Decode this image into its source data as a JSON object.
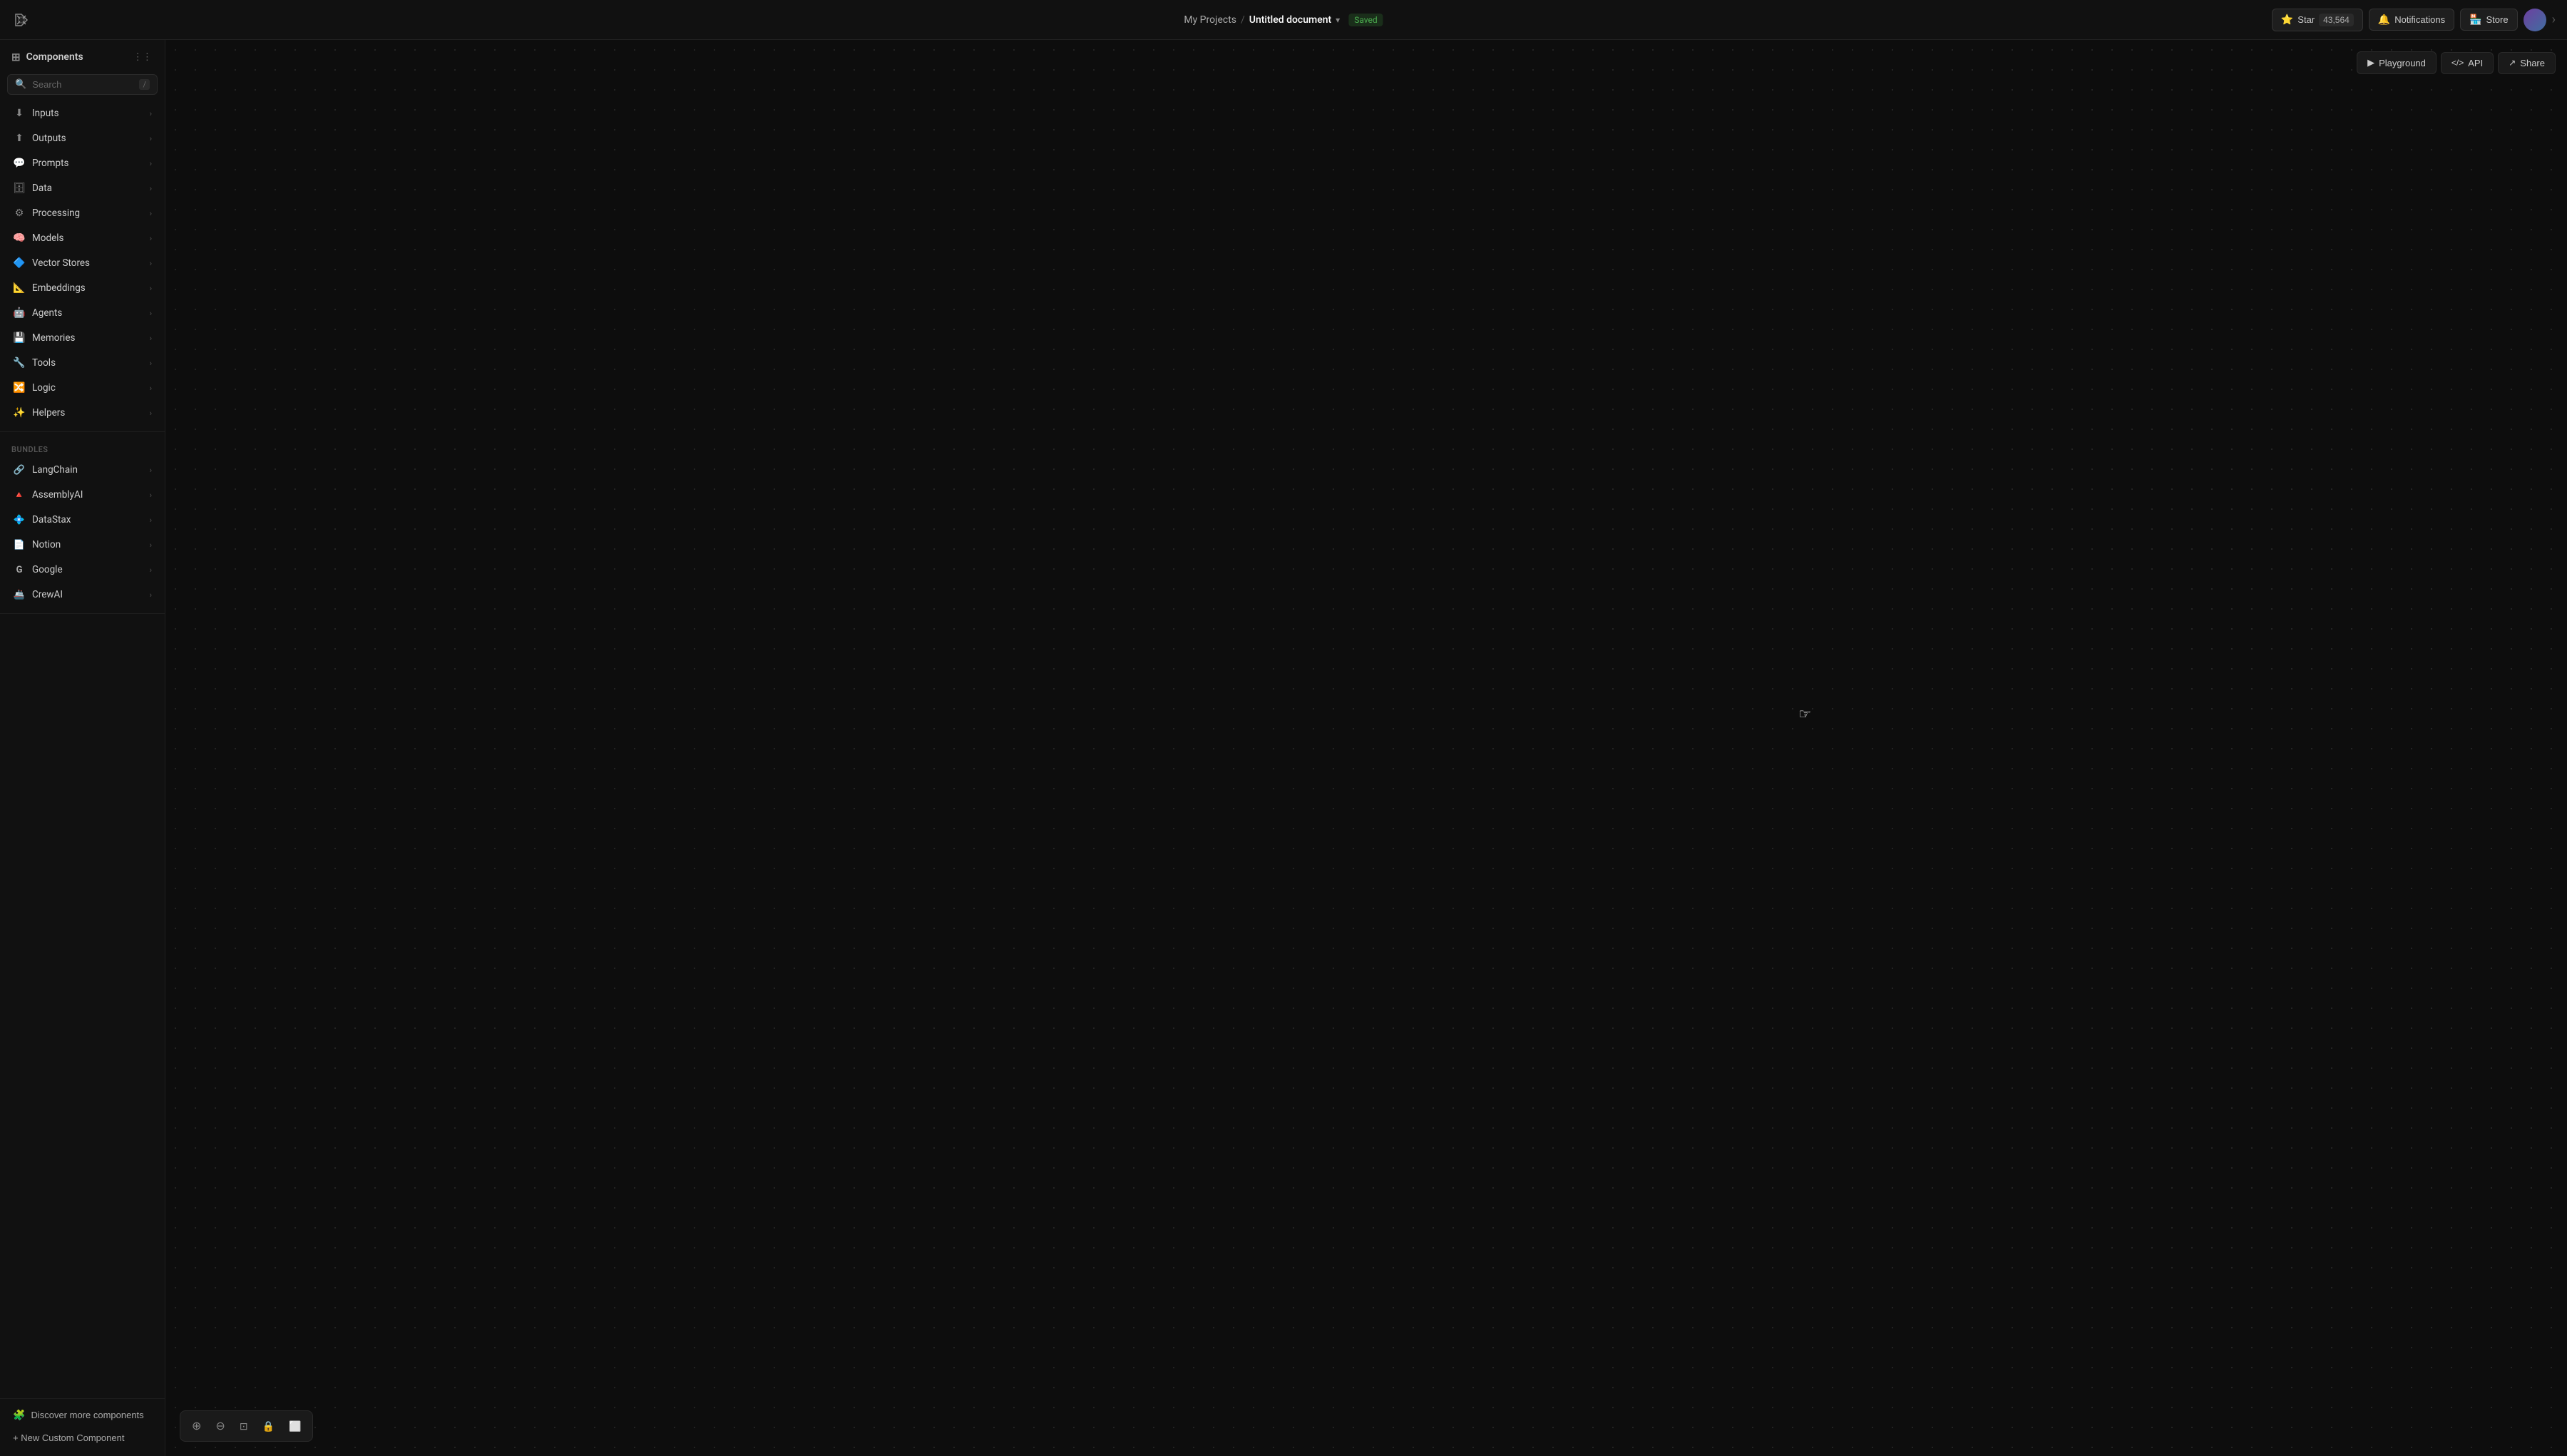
{
  "topbar": {
    "project_link": "My Projects",
    "separator": "/",
    "doc_name": "Untitled document",
    "saved_label": "Saved",
    "star_label": "Star",
    "star_count": "43,564",
    "notifications_label": "Notifications",
    "store_label": "Store",
    "playground_label": "Playground",
    "api_label": "API",
    "share_label": "Share"
  },
  "sidebar": {
    "title": "Components",
    "search_placeholder": "Search",
    "search_slash": "/",
    "items": [
      {
        "id": "inputs",
        "label": "Inputs",
        "icon": "⬇"
      },
      {
        "id": "outputs",
        "label": "Outputs",
        "icon": "⬆"
      },
      {
        "id": "prompts",
        "label": "Prompts",
        "icon": "💬"
      },
      {
        "id": "data",
        "label": "Data",
        "icon": "🗄"
      },
      {
        "id": "processing",
        "label": "Processing",
        "icon": "⚙"
      },
      {
        "id": "models",
        "label": "Models",
        "icon": "🧠"
      },
      {
        "id": "vector-stores",
        "label": "Vector Stores",
        "icon": "🔷"
      },
      {
        "id": "embeddings",
        "label": "Embeddings",
        "icon": "📐"
      },
      {
        "id": "agents",
        "label": "Agents",
        "icon": "🤖"
      },
      {
        "id": "memories",
        "label": "Memories",
        "icon": "💾"
      },
      {
        "id": "tools",
        "label": "Tools",
        "icon": "🔧"
      },
      {
        "id": "logic",
        "label": "Logic",
        "icon": "🔀"
      },
      {
        "id": "helpers",
        "label": "Helpers",
        "icon": "✨"
      }
    ],
    "bundles_label": "Bundles",
    "bundles": [
      {
        "id": "langchain",
        "label": "LangChain",
        "icon": "🔗"
      },
      {
        "id": "assemblyai",
        "label": "AssemblyAI",
        "icon": "🔺"
      },
      {
        "id": "datastax",
        "label": "DataStax",
        "icon": "💠"
      },
      {
        "id": "notion",
        "label": "Notion",
        "icon": "📄"
      },
      {
        "id": "google",
        "label": "Google",
        "icon": "G"
      },
      {
        "id": "crewai",
        "label": "CrewAI",
        "icon": "🚢"
      }
    ],
    "discover_label": "Discover more components",
    "new_component_label": "+ New Custom Component"
  },
  "canvas": {
    "playground_label": "Playground",
    "api_label": "API",
    "share_label": "Share"
  },
  "bottom_toolbar": {
    "zoom_in_title": "Zoom in",
    "zoom_out_title": "Zoom out",
    "fit_title": "Fit to screen",
    "lock_title": "Lock",
    "expand_title": "Expand"
  }
}
